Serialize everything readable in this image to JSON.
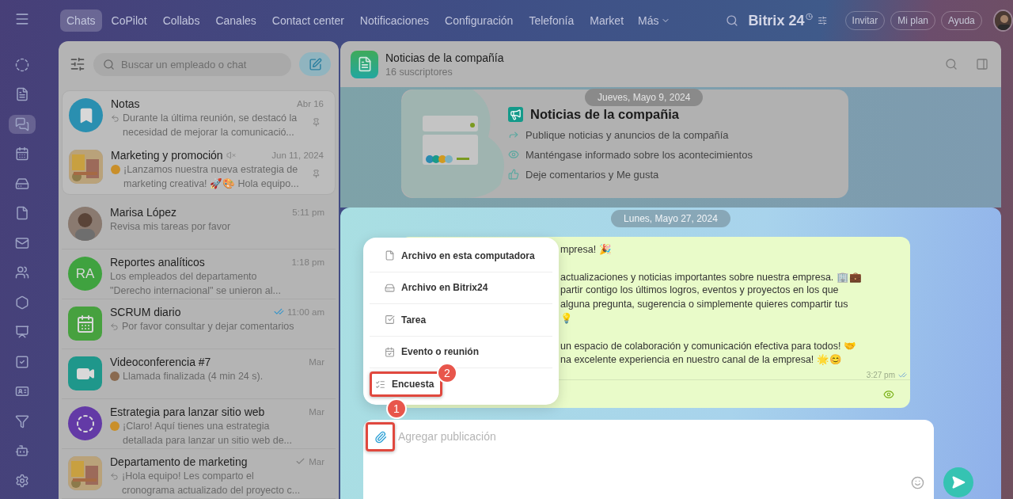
{
  "nav": {
    "tabs": [
      {
        "label": "Chats",
        "selected": true
      },
      {
        "label": "CoPilot",
        "selected": false
      },
      {
        "label": "Collabs",
        "selected": false
      },
      {
        "label": "Canales",
        "selected": false
      },
      {
        "label": "Contact center",
        "selected": false
      },
      {
        "label": "Notificaciones",
        "selected": false
      },
      {
        "label": "Configuración",
        "selected": false
      },
      {
        "label": "Telefonía",
        "selected": false
      },
      {
        "label": "Market",
        "selected": false
      }
    ],
    "more": "Más",
    "logo": "Bitrix 24",
    "buttons": [
      "Invitar",
      "Mi plan",
      "Ayuda"
    ]
  },
  "rail": [
    {
      "selected": false
    },
    {
      "selected": false
    },
    {
      "selected": true
    },
    {
      "selected": false
    },
    {
      "selected": false
    },
    {
      "selected": false
    },
    {
      "selected": false
    },
    {
      "selected": false
    },
    {
      "selected": false
    },
    {
      "selected": false
    },
    {
      "selected": false
    },
    {
      "selected": false
    },
    {
      "selected": false
    },
    {
      "selected": false
    },
    {
      "selected": false
    }
  ],
  "search": {
    "placeholder": "Buscar un empleado o chat"
  },
  "chats": [
    {
      "name": "Notas",
      "time": "Abr 16",
      "preview": "Durante la última reunión, se destacó la necesidad de mejorar la comunicació...",
      "avatar": {
        "kind": "bookmark"
      },
      "reply": true,
      "pinned": true,
      "muted": false,
      "delivered": false,
      "read": false,
      "sender": false
    },
    {
      "name": "Marketing y promoción",
      "time": "Jun 11, 2024",
      "preview": "¡Lanzamos nuestra nueva estrategia de marketing creativa! 🚀🎨 Hola equipo...",
      "reply": false,
      "pinned": true,
      "muted": true,
      "delivered": false,
      "read": false,
      "sender": true
    },
    {
      "name": "Marisa López",
      "time": "5:11 pm",
      "preview": "Revisa mis tareas por favor",
      "avatar": {
        "kind": "person"
      },
      "reply": false,
      "pinned": false,
      "muted": false,
      "delivered": false,
      "read": false,
      "sender": false
    },
    {
      "name": "Reportes analíticos",
      "time": "1:18 pm",
      "preview": "Los empleados del departamento \"Derecho internacional\" se unieron al...",
      "avatar": {
        "kind": "initials",
        "initials": "RA"
      },
      "reply": false,
      "pinned": false,
      "muted": false,
      "delivered": false,
      "read": false,
      "sender": false
    },
    {
      "name": "SCRUM diario",
      "time": "11:00 am",
      "preview": "Por favor consultar y dejar comentarios",
      "avatar": {
        "kind": "calendar"
      },
      "reply": true,
      "pinned": false,
      "muted": false,
      "delivered": true,
      "read": true,
      "sender": false
    },
    {
      "name": "Videoconferencia #7",
      "time": "Mar",
      "preview": "Llamada finalizada (4 min 24 s).",
      "avatar": {
        "kind": "video"
      },
      "reply": false,
      "pinned": false,
      "muted": false,
      "delivered": false,
      "read": false,
      "sender": true
    },
    {
      "name": "Estrategia para lanzar sitio web",
      "time": "Mar",
      "preview": "¡Claro! Aquí tienes una estrategia detallada para lanzar un sitio web de...",
      "avatar": {
        "kind": "copilot"
      },
      "reply": false,
      "pinned": false,
      "muted": false,
      "delivered": false,
      "read": false,
      "sender": true
    },
    {
      "name": "Departamento de marketing",
      "time": "Mar",
      "preview": "¡Hola equipo! Les comparto el cronograma actualizado del proyecto c...",
      "reply": true,
      "pinned": false,
      "muted": false,
      "delivered": true,
      "read": false,
      "sender": false
    }
  ],
  "channel": {
    "title": "Noticias de la compañía",
    "subtitle": "16 suscriptores"
  },
  "intro": {
    "date": "Jueves, Mayo 9, 2024",
    "title": "Noticias de la compañia",
    "features": [
      {
        "kind": "share",
        "text": "Publique noticias y anuncios de la compañía"
      },
      {
        "kind": "eye",
        "text": "Manténgase informado sobre los acontecimientos"
      },
      {
        "kind": "like",
        "text": "Deje comentarios y Me gusta"
      }
    ]
  },
  "message": {
    "date": "Lunes, Mayo 27, 2024",
    "paragraphs": [
      [
        "mpresa! 🎉"
      ],
      [
        "actualizaciones y noticias importantes sobre nuestra empresa. 🏢💼",
        "partir contigo los últimos logros, eventos y proyectos en los que",
        "alguna pregunta, sugerencia o simplemente quieres compartir tus",
        "💡"
      ],
      [
        "un espacio de colaboración y comunicación efectiva para todos! 🤝",
        "na excelente experiencia en nuestro canal de la empresa! 🌟😊"
      ]
    ],
    "time": "3:27 pm"
  },
  "menu": [
    {
      "kind": "file",
      "label": "Archivo en esta computadora",
      "highlighted": false
    },
    {
      "kind": "drive",
      "label": "Archivo en Bitrix24",
      "highlighted": false
    },
    {
      "kind": "task",
      "label": "Tarea",
      "highlighted": false
    },
    {
      "kind": "event",
      "label": "Evento o reunión",
      "highlighted": false
    },
    {
      "kind": "poll",
      "label": "Encuesta",
      "highlighted": true,
      "step": "2"
    }
  ],
  "composer": {
    "placeholder": "Agregar publicación",
    "highlighted": true,
    "step": "1"
  }
}
